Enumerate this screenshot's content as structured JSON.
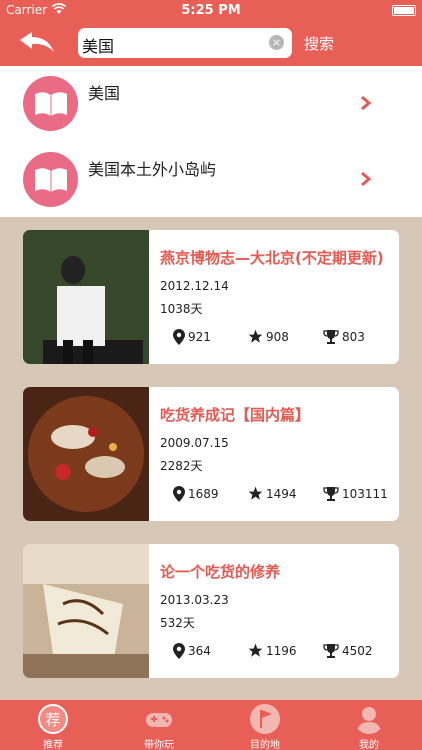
{
  "status_bar": {
    "carrier": "Carrier",
    "time": "5:25 PM"
  },
  "header": {
    "search_value": "美国",
    "search_button": "搜索"
  },
  "results": [
    {
      "label": "美国"
    },
    {
      "label": "美国本土外小岛屿"
    }
  ],
  "cards": [
    {
      "title": "燕京博物志—大北京(不定期更新)",
      "date": "2012.12.14",
      "days": "1038天",
      "location": "921",
      "stars": "908",
      "trophy": "803"
    },
    {
      "title": "吃货养成记【国内篇】",
      "date": "2009.07.15",
      "days": "2282天",
      "location": "1689",
      "stars": "1494",
      "trophy": "103111"
    },
    {
      "title": "论一个吃货的修养",
      "date": "2013.03.23",
      "days": "532天",
      "location": "364",
      "stars": "1196",
      "trophy": "4502"
    }
  ],
  "tabbar": [
    {
      "label": "推荐",
      "icon": "recommend-icon"
    },
    {
      "label": "带你玩",
      "icon": "gamepad-icon"
    },
    {
      "label": "目的地",
      "icon": "flag-icon"
    },
    {
      "label": "我的",
      "icon": "person-icon"
    }
  ],
  "colors": {
    "accent": "#e85f57",
    "title_red": "#e35a53",
    "background": "#d6c7b6"
  }
}
